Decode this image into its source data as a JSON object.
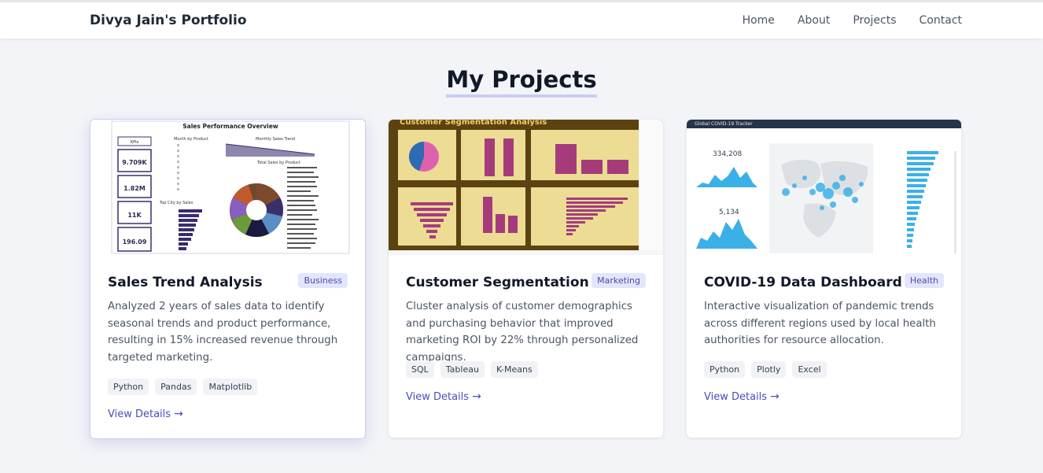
{
  "nav": {
    "brand": "Divya Jain's Portfolio",
    "links": [
      "Home",
      "About",
      "Projects",
      "Contact"
    ]
  },
  "section": {
    "title": "My Projects"
  },
  "projects": [
    {
      "title": "Sales Trend Analysis",
      "category": "Business",
      "description": "Analyzed 2 years of sales data to identify seasonal trends and product performance, resulting in 15% increased revenue through targeted marketing.",
      "tags": [
        "Python",
        "Pandas",
        "Matplotlib"
      ],
      "link": "View Details",
      "thumb": {
        "heading": "Sales Performance Overview",
        "kpi_label": "KPIs",
        "kpis": [
          "9.709K",
          "1.82M",
          "11K",
          "196.09"
        ],
        "month_label": "Month by Product",
        "trend_label": "Monthly Sales Trend",
        "city_label": "Top City by Sales",
        "product_label": "Total Sales by Product"
      }
    },
    {
      "title": "Customer Segmentation",
      "category": "Marketing",
      "description": "Cluster analysis of customer demographics and purchasing behavior that improved marketing ROI by 22% through personalized campaigns.",
      "tags": [
        "SQL",
        "Tableau",
        "K-Means"
      ],
      "link": "View Details",
      "thumb": {
        "heading": "Customer Segmentation Analysis"
      }
    },
    {
      "title": "COVID-19 Data Dashboard",
      "category": "Health",
      "description": "Interactive visualization of pandemic trends across different regions used by local health authorities for resource allocation.",
      "tags": [
        "Python",
        "Plotly",
        "Excel"
      ],
      "link": "View Details",
      "thumb": {
        "heading": "Global COVID-19 Tracker",
        "stat1": "334,208",
        "stat2": "5,134"
      }
    }
  ],
  "colors": {
    "accent": "#4b4cc0",
    "badge_bg": "#e3e6fb",
    "thumb2_bg": "#5b4210",
    "thumb2_panel": "#ecdc94",
    "thumb2_bar": "#a63b7c",
    "thumb3_blue": "#3bb0e6"
  }
}
